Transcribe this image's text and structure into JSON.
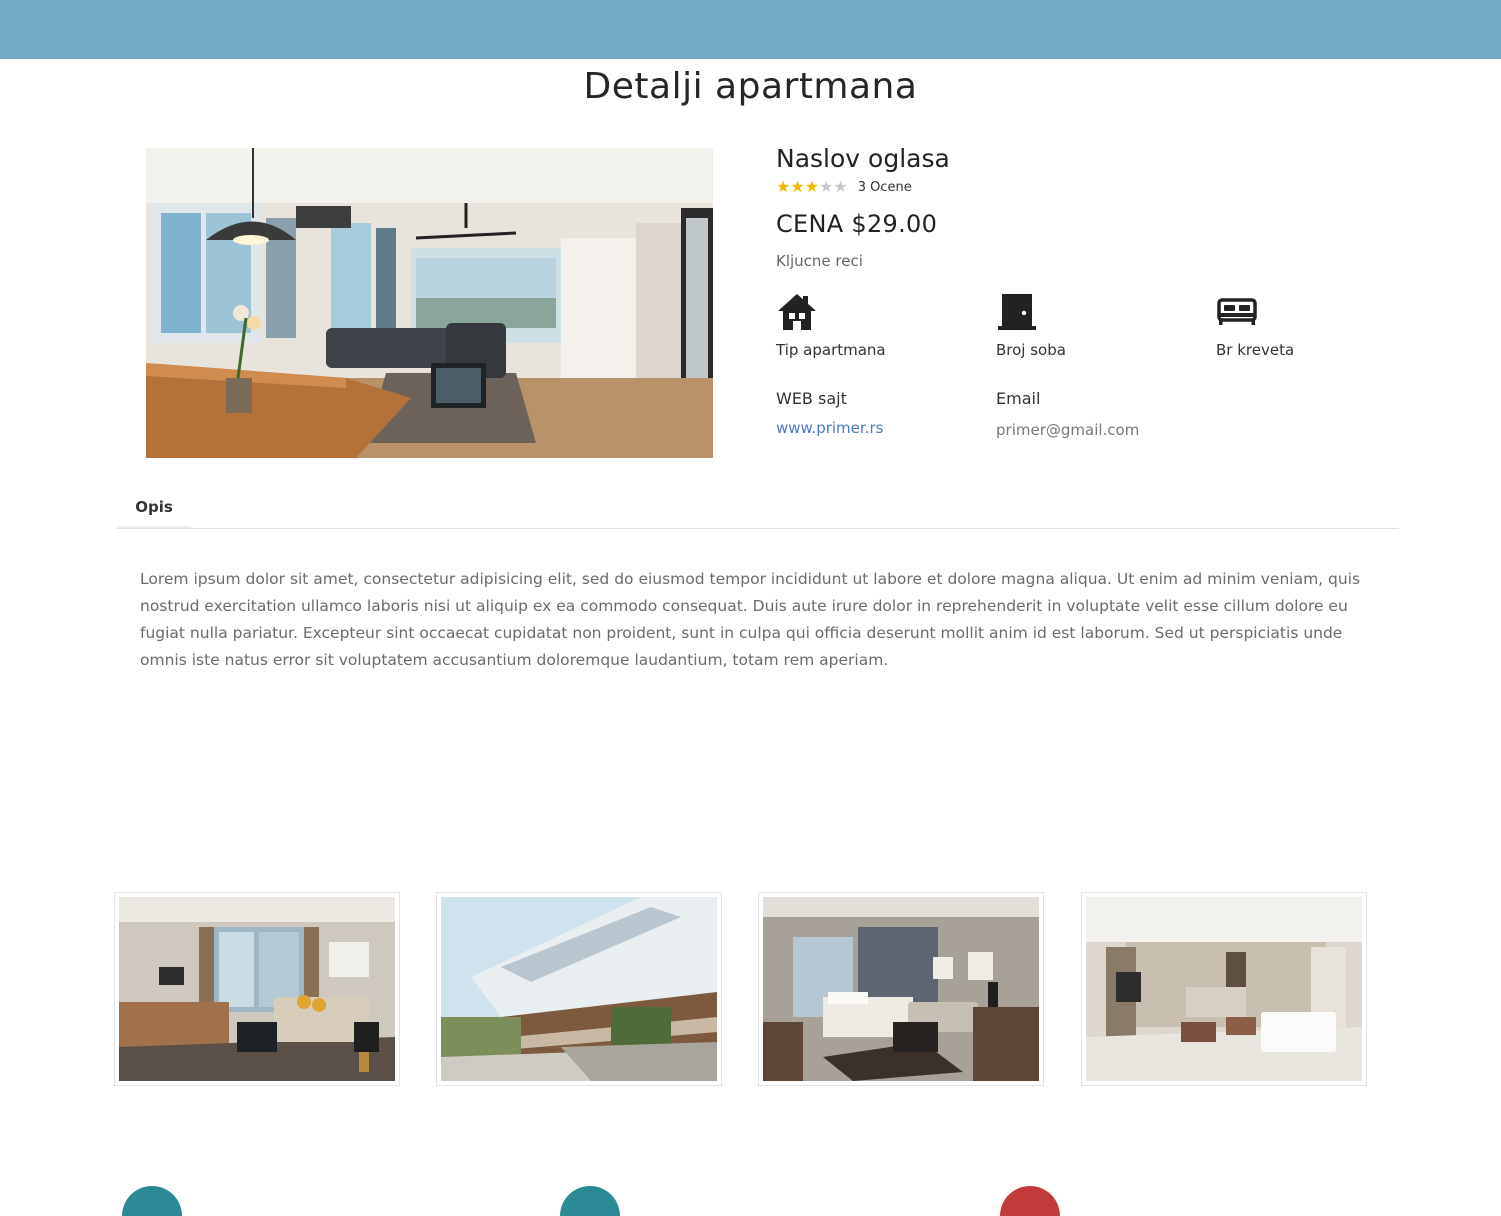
{
  "page": {
    "title": "Detalji apartmana"
  },
  "listing": {
    "title": "Naslov oglasa",
    "rating": {
      "stars_filled": 3,
      "stars_total": 5,
      "count_label": "3 Ocene"
    },
    "price": "CENA $29.00",
    "keywords": "Kljucne reci",
    "features": [
      {
        "icon": "house-icon",
        "label": "Tip apartmana"
      },
      {
        "icon": "door-icon",
        "label": "Broj soba"
      },
      {
        "icon": "bed-icon",
        "label": "Br kreveta"
      }
    ],
    "web_label": "WEB sajt",
    "web_value": "www.primer.rs",
    "email_label": "Email",
    "email_value": "primer@gmail.com"
  },
  "tabs": [
    {
      "label": "Opis"
    }
  ],
  "description": "Lorem ipsum dolor sit amet, consectetur adipisicing elit, sed do eiusmod tempor incididunt ut labore et dolore magna aliqua. Ut enim ad minim veniam, quis nostrud exercitation ullamco laboris nisi ut aliquip ex ea commodo consequat. Duis aute irure dolor in reprehenderit in voluptate velit esse cillum dolore eu fugiat nulla pariatur. Excepteur sint occaecat cupidatat non proident, sunt in culpa qui officia deserunt mollit anim id est laborum. Sed ut perspiciatis unde omnis iste natus error sit voluptatem accusantium doloremque laudantium, totam rem aperiam.",
  "colors": {
    "header": "#74aac4",
    "star": "#f2b800",
    "link": "#4a78c9"
  }
}
